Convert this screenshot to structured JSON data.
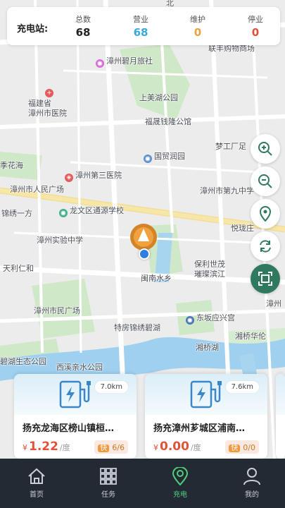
{
  "stats": {
    "label": "充电站:",
    "items": [
      {
        "title": "总数",
        "value": "68",
        "color": "#222222"
      },
      {
        "title": "营业",
        "value": "68",
        "color": "#3aa8d8"
      },
      {
        "title": "维护",
        "value": "0",
        "color": "#e8a33c"
      },
      {
        "title": "停业",
        "value": "0",
        "color": "#e0523a"
      }
    ]
  },
  "map": {
    "pois": [
      "北",
      "联丰购物商场",
      "漳州碧月旅社",
      "福建省",
      "漳州市医院",
      "上美湖公园",
      "福晟钱隆公馆",
      "梦工厂足",
      "季花海",
      "国贸润园",
      "漳州第三医院",
      "漳州市人民广场",
      "漳州市第九中学",
      "锦绣一方",
      "龙文区通源学校",
      "悦珑庄",
      "漳州实验中学",
      "保利世茂",
      "璀璨滨江",
      "天利仁和",
      "闽南水乡",
      "漳州",
      "漳州市民广场",
      "东坂应兴宫",
      "特房锦绣碧湖",
      "湘桥华伦",
      "湘桥湖",
      "碧湖生态公园",
      "西溪亲水公园"
    ]
  },
  "controls": [
    "zoom-in-icon",
    "zoom-out-icon",
    "locate-icon",
    "refresh-icon",
    "scan-icon"
  ],
  "cards": [
    {
      "distance": "7.0km",
      "name": "扬充龙海区榜山镇桓…",
      "currency": "¥",
      "price": "1.22",
      "unit": "/度",
      "fast_tag": "快",
      "fast_count": "6/6"
    },
    {
      "distance": "7.6km",
      "name": "扬充漳州芗城区浦南…",
      "currency": "¥",
      "price": "0.00",
      "unit": "/度",
      "fast_tag": "快",
      "fast_count": "0/0"
    }
  ],
  "tabs": [
    {
      "label": "首页",
      "icon": "home-icon",
      "active": false
    },
    {
      "label": "任务",
      "icon": "grid-icon",
      "active": false
    },
    {
      "label": "充电",
      "icon": "charge-pin-icon",
      "active": true
    },
    {
      "label": "我的",
      "icon": "profile-icon",
      "active": false
    }
  ]
}
